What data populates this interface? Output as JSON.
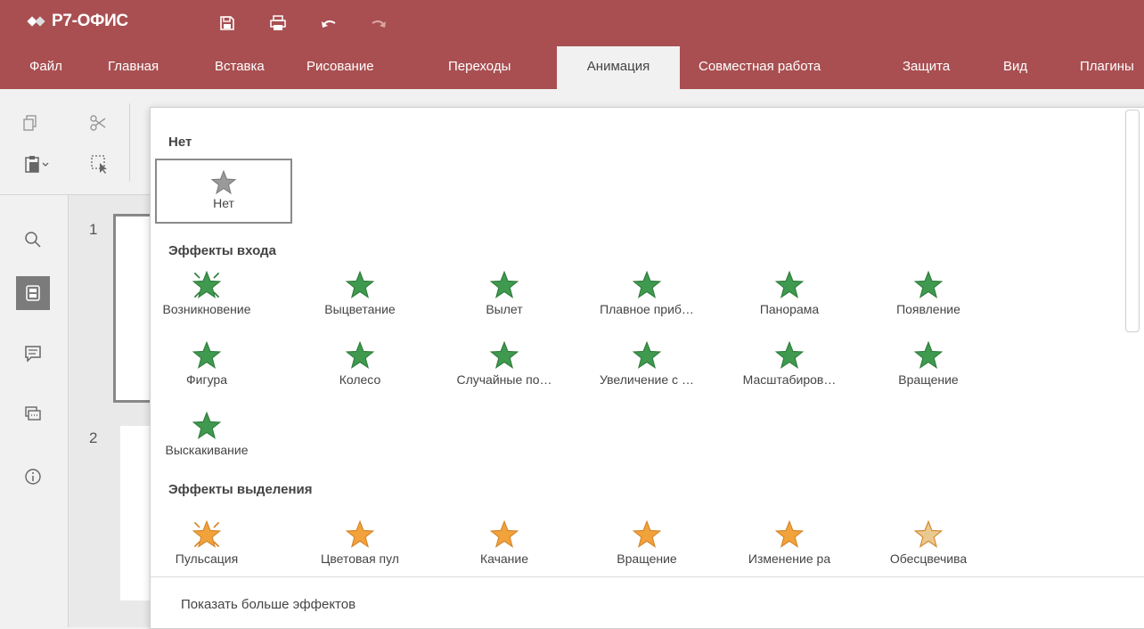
{
  "app": {
    "logo_text": "Р7-ОФИС"
  },
  "quick_access": [
    "save-icon",
    "print-icon",
    "undo-icon",
    "redo-icon"
  ],
  "tabs": [
    {
      "label": "Файл"
    },
    {
      "label": "Главная"
    },
    {
      "label": "Вставка"
    },
    {
      "label": "Рисование"
    },
    {
      "label": "Переходы"
    },
    {
      "label": "Анимация",
      "active": true
    },
    {
      "label": "Совместная работа"
    },
    {
      "label": "Защита"
    },
    {
      "label": "Вид"
    },
    {
      "label": "Плагины"
    }
  ],
  "slides": [
    {
      "num": "1"
    },
    {
      "num": "2"
    }
  ],
  "menu": {
    "section_none": "Нет",
    "none_label": "Нет",
    "section_entrance": "Эффекты входа",
    "entrance": [
      "Возникновение",
      "Выцветание",
      "Вылет",
      "Плавное приб…",
      "Панорама",
      "Появление",
      "Фигура",
      "Колесо",
      "Случайные по…",
      "Увеличение с …",
      "Масштабиров…",
      "Вращение",
      "Выскакивание"
    ],
    "section_emphasis": "Эффекты выделения",
    "emphasis": [
      "Пульсация",
      "Цветовая пул",
      "Качание",
      "Вращение",
      "Изменение ра",
      "Обесцвечива"
    ],
    "more_effects": "Показать больше эффектов"
  },
  "colors": {
    "brand": "#a94f51",
    "entrance": "#3f9a4f",
    "emphasis": "#f2a23a"
  }
}
